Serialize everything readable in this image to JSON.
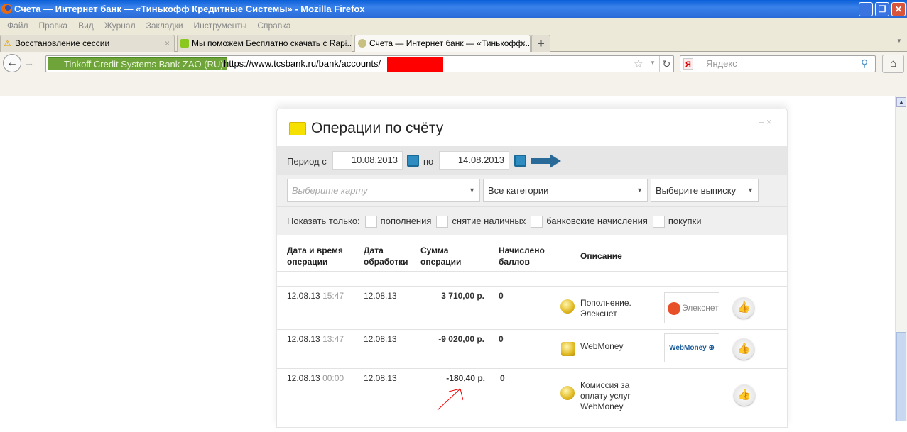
{
  "window": {
    "title": "Счета — Интернет банк — «Тинькофф Кредитные Системы» - Mozilla Firefox"
  },
  "menu": [
    "Файл",
    "Правка",
    "Вид",
    "Журнал",
    "Закладки",
    "Инструменты",
    "Справка"
  ],
  "tabs": [
    {
      "label": "Восстановление сессии"
    },
    {
      "label": "Мы поможем Бесплатно скачать с Rapi..."
    },
    {
      "label": "Счета — Интернет банк — «Тинькофф..."
    }
  ],
  "urlbar": {
    "identity": "Tinkoff Credit Systems Bank ZAO (RU)",
    "url": "https://www.tcsbank.ru/bank/accounts/"
  },
  "search": {
    "placeholder": "Яндекс"
  },
  "panel": {
    "title": "Операции по счёту",
    "period_label": "Период с",
    "date_from": "10.08.2013",
    "to_label": "по",
    "date_to": "14.08.2013",
    "card_select_placeholder": "Выберите карту",
    "category_select": "Все категории",
    "statement_select": "Выберите выписку",
    "filter_label": "Показать только:",
    "filters": [
      "пополнения",
      "снятие наличных",
      "банковские начисления",
      "покупки"
    ],
    "columns": {
      "datetime": [
        "Дата и время",
        "операции"
      ],
      "processed": [
        "Дата",
        "обработки"
      ],
      "amount": [
        "Сумма",
        "операции"
      ],
      "points": [
        "Начислено",
        "баллов"
      ],
      "description": "Описание"
    },
    "rows": [
      {
        "date": "12.08.13",
        "time": "15:47",
        "processed": "12.08.13",
        "amount": "3 710,00 р.",
        "points": "0",
        "description": [
          "Пополнение.",
          "Элекснет"
        ],
        "logo": "Элекснет"
      },
      {
        "date": "12.08.13",
        "time": "13:47",
        "processed": "12.08.13",
        "amount": "-9 020,00 р.",
        "points": "0",
        "description": [
          "WebMoney"
        ],
        "logo": "WebMoney"
      },
      {
        "date": "12.08.13",
        "time": "00:00",
        "processed": "12.08.13",
        "amount": "-180,40 р.",
        "points": "0",
        "description": [
          "Комиссия за",
          "оплату услуг",
          "WebMoney"
        ]
      }
    ]
  }
}
